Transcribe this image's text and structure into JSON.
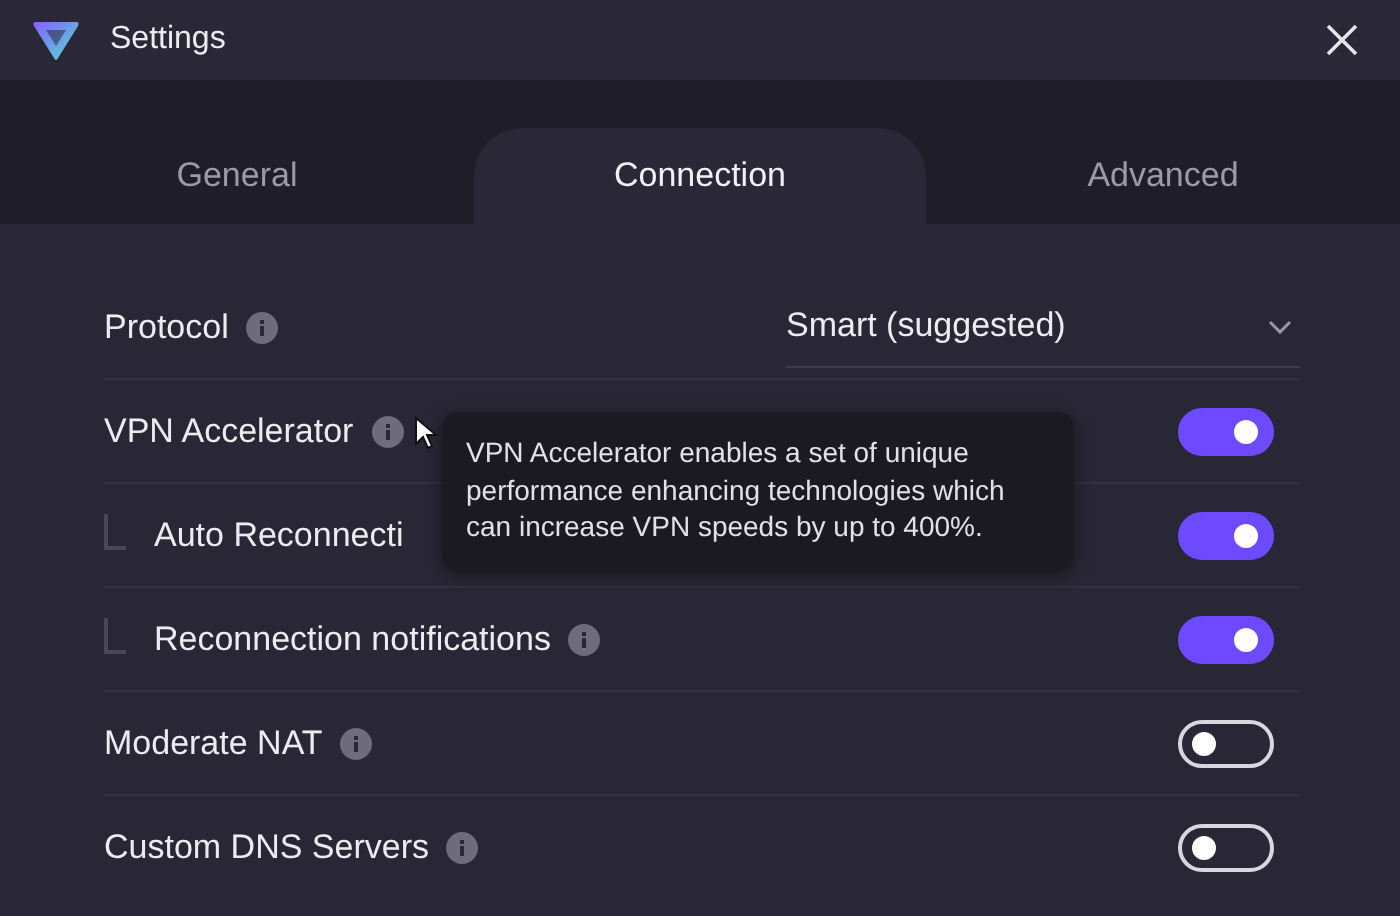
{
  "window": {
    "title": "Settings"
  },
  "tabs": [
    {
      "label": "General",
      "selected": false
    },
    {
      "label": "Connection",
      "selected": true
    },
    {
      "label": "Advanced",
      "selected": false
    }
  ],
  "settings": [
    {
      "kind": "dropdown",
      "label": "Protocol",
      "value": "Smart (suggested)"
    },
    {
      "kind": "toggle",
      "label": "VPN Accelerator",
      "on": true,
      "children": [
        {
          "kind": "toggle",
          "label": "Auto Reconnecti",
          "on": true
        },
        {
          "kind": "toggle",
          "label": "Reconnection notifications",
          "on": true
        }
      ]
    },
    {
      "kind": "toggle",
      "label": "Moderate NAT",
      "on": false
    },
    {
      "kind": "toggle",
      "label": "Custom DNS Servers",
      "on": false
    }
  ],
  "tooltip": {
    "text": "VPN Accelerator enables a set of unique performance enhancing technologies which can increase VPN speeds by up to 400%."
  }
}
